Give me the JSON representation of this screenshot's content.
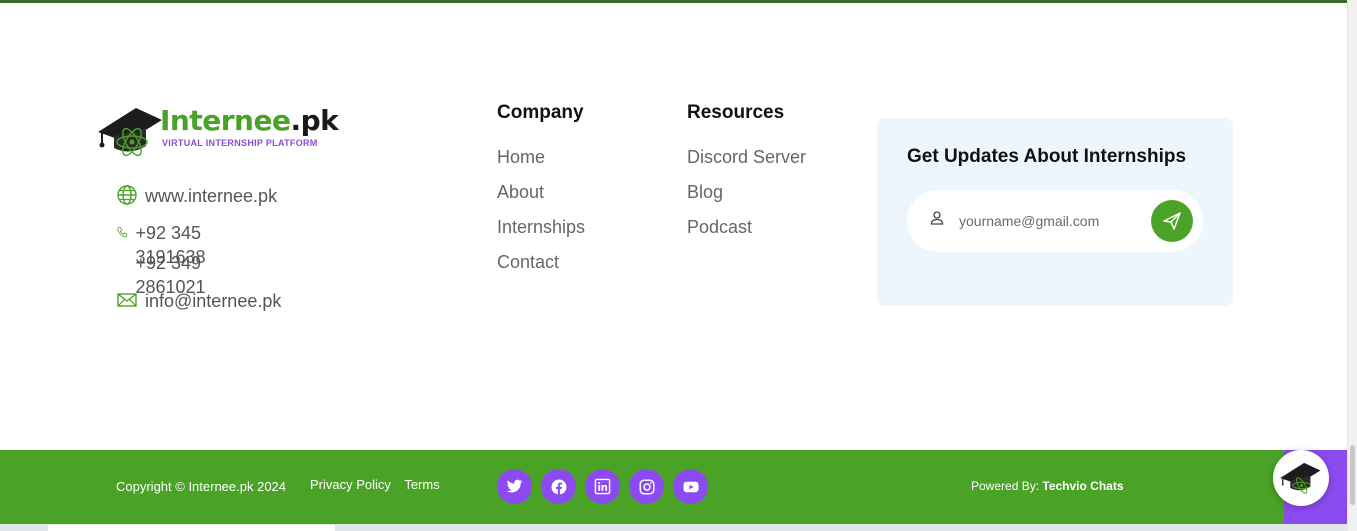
{
  "brand": {
    "name_green": "Internee",
    "name_dark": ".pk",
    "tagline": "VIRTUAL INTERNSHIP PLATFORM"
  },
  "contact": {
    "website": "www.internee.pk",
    "phone_1": "+92 345 3191638",
    "phone_2": "+92 349 2861021",
    "email": "info@internee.pk"
  },
  "company": {
    "heading": "Company",
    "links": [
      "Home",
      "About",
      "Internships",
      "Contact"
    ]
  },
  "resources": {
    "heading": "Resources",
    "links": [
      "Discord Server",
      "Blog",
      "Podcast"
    ]
  },
  "newsletter": {
    "heading": "Get Updates About Internships",
    "placeholder": "yourname@gmail.com"
  },
  "footer": {
    "copyright": "Copyright © Internee.pk 2024",
    "privacy": "Privacy Policy",
    "terms": "Terms",
    "powered_prefix": "Powered By: ",
    "powered_name": "Techvio Chats",
    "social": [
      "twitter-icon",
      "facebook-icon",
      "linkedin-icon",
      "instagram-icon",
      "youtube-icon"
    ]
  },
  "colors": {
    "green": "#4aa326",
    "purple": "#8c4bf0",
    "panel": "#eef6fd"
  }
}
